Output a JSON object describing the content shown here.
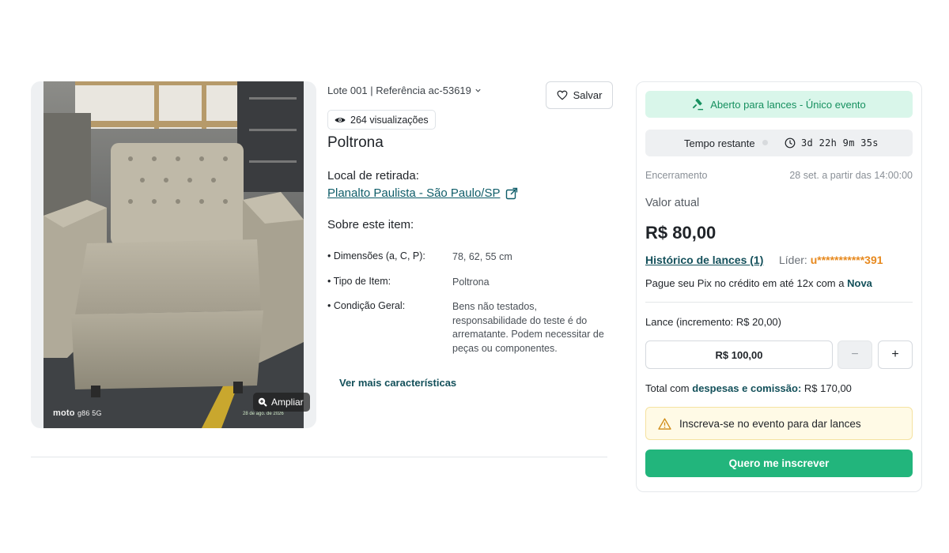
{
  "photo": {
    "zoom_label": "Ampliar",
    "phone_brand": "moto",
    "phone_model": "g86 5G",
    "photo_date": "28 de ago. de 2026"
  },
  "item": {
    "lot_ref": "Lote 001 | Referência ac-53619",
    "save_label": "Salvar",
    "views": "264 visualizações",
    "title": "Poltrona",
    "pickup_label": "Local de retirada:",
    "pickup_location": "Planalto Paulista - São Paulo/SP",
    "about_label": "Sobre este item:",
    "specs": [
      {
        "key": "Dimensões (a, C, P):",
        "value": "78, 62, 55 cm"
      },
      {
        "key": "Tipo de Item:",
        "value": "Poltrona"
      },
      {
        "key": "Condição Geral:",
        "value": "Bens não testados, responsabilidade do teste é do arrematante. Podem necessitar de peças ou componentes."
      }
    ],
    "more_link": "Ver mais características"
  },
  "bid": {
    "status": "Aberto para lances - Único evento",
    "timer_label": "Tempo restante",
    "timer_value": "3d 22h 9m 35s",
    "closing_label": "Encerramento",
    "closing_value": "28 set. a partir das 14:00:00",
    "current_label": "Valor atual",
    "current_value": "R$ 80,00",
    "history_link": "Histórico de lances (1)",
    "leader_label": "Líder:",
    "leader_user": "u***********391",
    "pix_prefix": "Pague seu Pix no crédito em até 12x com a",
    "pix_brand": "Nova",
    "bid_label": "Lance (incremento: R$ 20,00)",
    "bid_value": "R$ 100,00",
    "minus": "−",
    "plus": "+",
    "total_prefix": "Total com",
    "total_fees": "despesas e comissão:",
    "total_value": "R$ 170,00",
    "warning": "Inscreva-se no evento para dar lances",
    "subscribe": "Quero me inscrever"
  },
  "colors": {
    "accent_green": "#22b57c",
    "status_green_bg": "#d9f6ea",
    "link_teal": "#0f5d69",
    "leader_orange": "#e7891e",
    "warning_bg": "#fffae6"
  }
}
